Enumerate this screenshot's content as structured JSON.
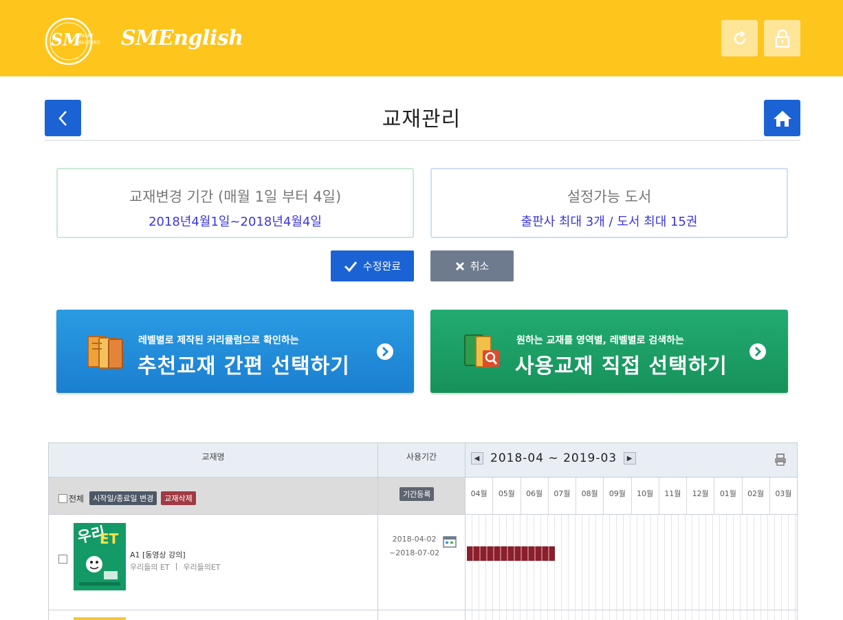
{
  "header": {
    "logo_text": "SMART MASTERS",
    "brand": "SMEnglish",
    "refresh_label": "",
    "lock_label": ""
  },
  "title_bar": {
    "title": "교재관리"
  },
  "info": {
    "period_title": "교재변경 기간 (매월 1일 부터 4일)",
    "period_value": "2018년4월1일~2018년4월4일",
    "limit_title": "설정가능 도서",
    "limit_value": "출판사 최대 3개 / 도서 최대 15권"
  },
  "actions": {
    "save_label": "수정완료",
    "cancel_label": "취소"
  },
  "banners": {
    "recommend_sub": "레벨별로 제작된 커리큘럼으로 확인하는",
    "recommend_main": "추천교재 간편 선택하기",
    "direct_sub": "원하는 교재를 영역별, 레벨별로 검색하는",
    "direct_main": "사용교재 직접 선택하기"
  },
  "table": {
    "col_name": "교재명",
    "col_period": "사용기간",
    "range_label": "2018-04 ~ 2019-03",
    "select_all_label": "전체",
    "change_dates_label": "시작일/종료일 변경",
    "delete_label": "교재삭제",
    "period_set_label": "기간등록",
    "months": [
      "04월",
      "05월",
      "06월",
      "07월",
      "08월",
      "09월",
      "10월",
      "11월",
      "12월",
      "01월",
      "02월",
      "03월"
    ],
    "rows": [
      {
        "title": "A1 [동영상 강의]",
        "publisher": "우리들의 ET",
        "series": "우리들의ET",
        "start": "2018-04-02",
        "end": "~2018-07-02",
        "cover_text": "우리들의 ET"
      }
    ]
  },
  "colors": {
    "header_bg": "#fec51c",
    "primary": "#1b63d4",
    "banner_blue": "#1f8bd8",
    "banner_green": "#1a9d63",
    "gantt_bar": "#8a1f2b"
  }
}
